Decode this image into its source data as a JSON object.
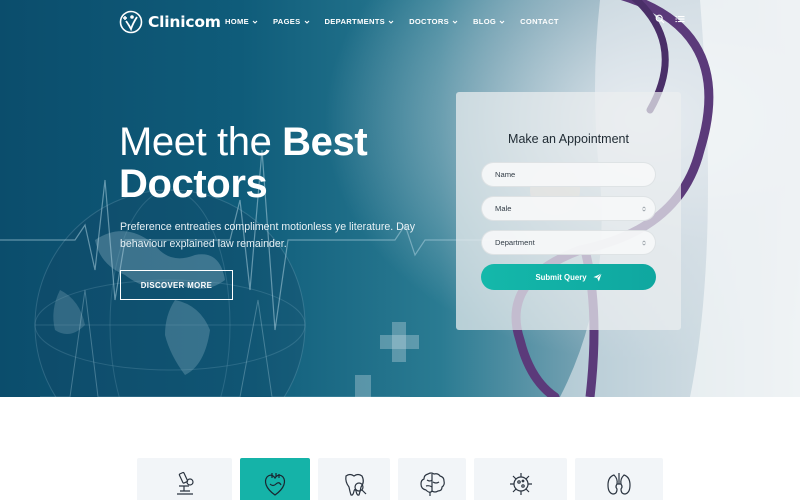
{
  "brand": {
    "name": "Clinicom"
  },
  "nav": {
    "items": [
      {
        "label": "HOME",
        "has_dropdown": true
      },
      {
        "label": "PAGES",
        "has_dropdown": true
      },
      {
        "label": "DEPARTMENTS",
        "has_dropdown": true
      },
      {
        "label": "DOCTORS",
        "has_dropdown": true
      },
      {
        "label": "BLOG",
        "has_dropdown": true
      },
      {
        "label": "CONTACT",
        "has_dropdown": false
      }
    ],
    "icons": [
      "search-icon",
      "menu-icon"
    ]
  },
  "hero": {
    "headline_light": "Meet the",
    "headline_bold_1": "Best",
    "headline_bold_2": "Doctors",
    "lead": "Preference entreaties compliment motionless ye literature. Day behaviour explained law remainder.",
    "cta_label": "DISCOVER MORE"
  },
  "appointment": {
    "title": "Make an Appointment",
    "name_placeholder": "Name",
    "gender_value": "Male",
    "department_value": "Department",
    "submit_label": "Submit Query"
  },
  "services": {
    "icons": [
      "microscope-icon",
      "heart-icon",
      "tooth-icon",
      "brain-icon",
      "virus-icon",
      "kidney-icon"
    ],
    "active_index": 1
  },
  "colors": {
    "accent": "#15b3a8",
    "hero_dark": "#0b4d6c",
    "card_bg": "#ebeef0"
  }
}
